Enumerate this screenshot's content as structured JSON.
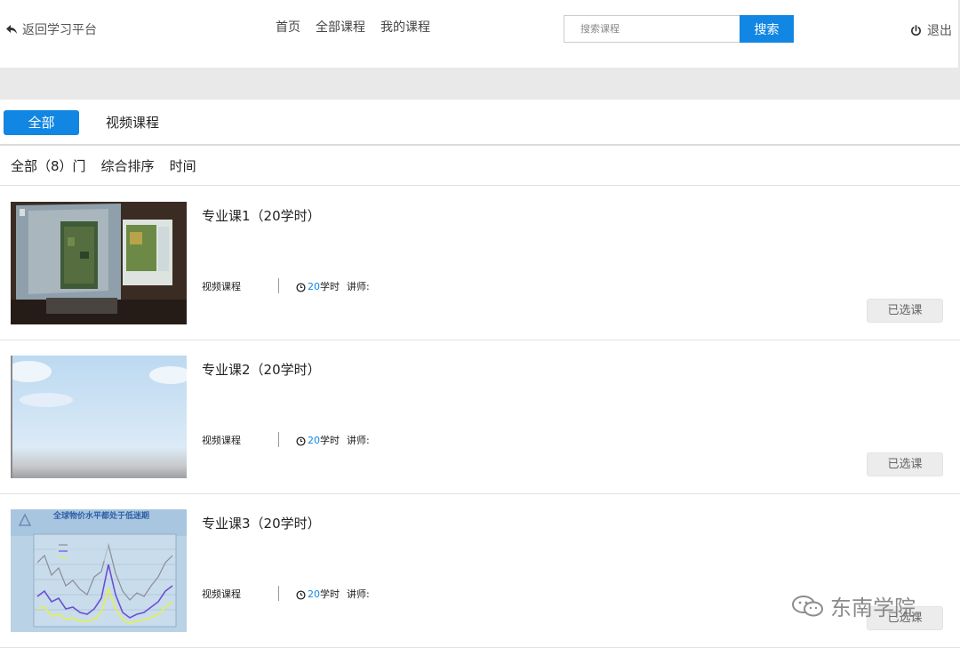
{
  "header": {
    "back_label": "返回学习平台",
    "nav": [
      "首页",
      "全部课程",
      "我的课程"
    ],
    "search": {
      "placeholder": "搜索课程",
      "button_label": "搜索"
    },
    "logout_label": "退出"
  },
  "tabs": {
    "all_label": "全部",
    "video_label": "视频课程"
  },
  "filter": {
    "count_label": "全部（8）门",
    "sort_label": "综合排序",
    "time_label": "时间"
  },
  "courses": [
    {
      "title": "专业课1（20学时）",
      "type": "视频课程",
      "hours": "20",
      "hours_unit": "学时",
      "teacher_label": "讲师:",
      "button_label": "已选课"
    },
    {
      "title": "专业课2（20学时）",
      "type": "视频课程",
      "hours": "20",
      "hours_unit": "学时",
      "teacher_label": "讲师:",
      "button_label": "已选课"
    },
    {
      "title": "专业课3（20学时）",
      "type": "视频课程",
      "hours": "20",
      "hours_unit": "学时",
      "teacher_label": "讲师:",
      "button_label": "已选课"
    }
  ],
  "thumbnail3_title": "全球物价水平都处于低迷期",
  "watermark": "东南学院",
  "colors": {
    "accent": "#1286e3",
    "header_bg": "#ffffff",
    "band_bg": "#e9e9e9",
    "button_gray": "#ececec"
  }
}
